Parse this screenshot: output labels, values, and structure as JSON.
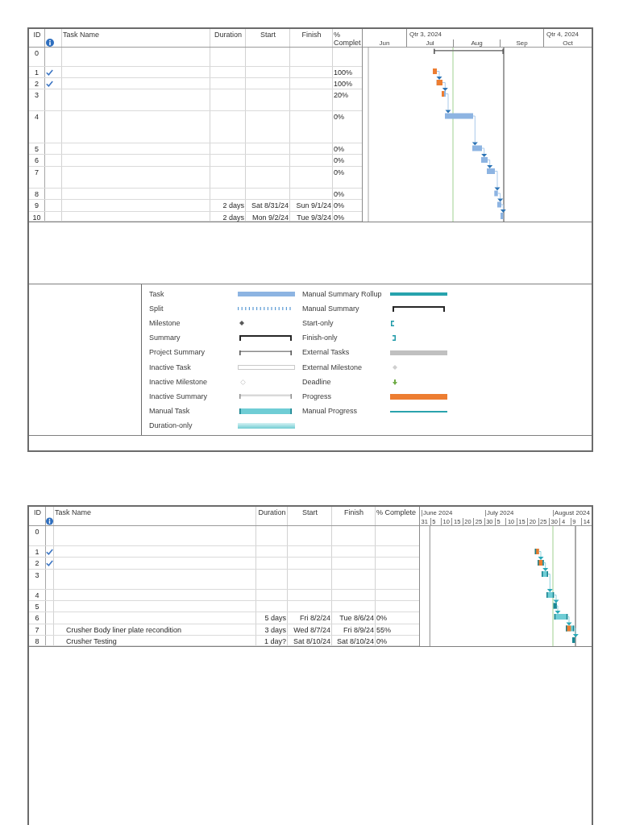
{
  "pages": [
    {
      "table": {
        "columns": [
          {
            "kind": "id",
            "label": "ID"
          },
          {
            "kind": "indicators"
          },
          {
            "kind": "name",
            "label": "Task Name"
          },
          {
            "kind": "duration",
            "label": "Duration"
          },
          {
            "kind": "start",
            "label": "Start"
          },
          {
            "kind": "finish",
            "label": "Finish"
          },
          {
            "kind": "complete",
            "label": "% Complet"
          }
        ],
        "rows": [
          {
            "id": "0",
            "done": false,
            "children": [
              {
                "id": "1",
                "done": true,
                "complete": "100%"
              },
              {
                "id": "2",
                "done": true,
                "complete": "100%"
              },
              {
                "id": "3",
                "done": false,
                "complete": "20%"
              },
              {
                "id": "4",
                "done": false,
                "complete": "0%"
              },
              {
                "id": "5",
                "done": false,
                "complete": "0%"
              },
              {
                "id": "6",
                "done": false,
                "complete": "0%"
              },
              {
                "id": "7",
                "done": false,
                "complete": "0%"
              },
              {
                "id": "8",
                "done": false,
                "complete": "0%"
              },
              {
                "id": "9",
                "done": false,
                "duration": "2 days",
                "start": "Sat 8/31/24",
                "finish": "Sun 9/1/24",
                "complete": "0%"
              },
              {
                "id": "10",
                "done": false,
                "duration": "2 days",
                "start": "Mon 9/2/24",
                "finish": "Tue 9/3/24",
                "complete": "0%"
              }
            ]
          }
        ]
      },
      "gantt": {
        "timescale": {
          "upper_tier": [
            "Qtr 3, 2024",
            "Qtr 4, 2024"
          ],
          "lower_tier": [
            "Jun",
            "Jul",
            "Aug",
            "Sep",
            "Oct"
          ]
        }
      },
      "legend": {
        "columns": [
          {
            "items": [
              {
                "label": "Task",
                "kind": "task"
              },
              {
                "label": "Split",
                "kind": "split"
              },
              {
                "label": "Milestone",
                "kind": "milestone"
              },
              {
                "label": "Summary",
                "kind": "summary"
              },
              {
                "label": "Project Summary",
                "kind": "project_summary"
              },
              {
                "label": "Inactive Task",
                "kind": "inactive_task"
              },
              {
                "label": "Inactive Milestone",
                "kind": "inactive_milestone"
              },
              {
                "label": "Inactive Summary",
                "kind": "inactive_summary"
              },
              {
                "label": "Manual Task",
                "kind": "manual_task"
              },
              {
                "label": "Duration-only",
                "kind": "duration_only"
              }
            ]
          },
          {
            "items": [
              {
                "label": "Manual Summary Rollup",
                "kind": "manual_summary_rollup"
              },
              {
                "label": "Manual Summary",
                "kind": "manual_summary"
              },
              {
                "label": "Start-only",
                "kind": "start_only"
              },
              {
                "label": "Finish-only",
                "kind": "finish_only"
              },
              {
                "label": "External Tasks",
                "kind": "external_tasks"
              },
              {
                "label": "External Milestone",
                "kind": "external_milestone"
              },
              {
                "label": "Deadline",
                "kind": "deadline"
              },
              {
                "label": "Progress",
                "kind": "progress"
              },
              {
                "label": "Manual Progress",
                "kind": "manual_progress"
              }
            ]
          }
        ]
      }
    },
    {
      "table": {
        "columns": [
          {
            "kind": "id",
            "label": "ID"
          },
          {
            "kind": "indicators"
          },
          {
            "kind": "name",
            "label": "Task Name"
          },
          {
            "kind": "duration",
            "label": "Duration"
          },
          {
            "kind": "start",
            "label": "Start"
          },
          {
            "kind": "finish",
            "label": "Finish"
          },
          {
            "kind": "complete",
            "label": "% Complete"
          }
        ],
        "rows": [
          {
            "id": "0",
            "done": false,
            "children": [
              {
                "id": "1",
                "done": true
              },
              {
                "id": "2",
                "done": true
              },
              {
                "id": "3",
                "done": false
              },
              {
                "id": "4",
                "done": false
              },
              {
                "id": "5",
                "done": false
              },
              {
                "id": "6",
                "done": false,
                "duration": "5 days",
                "start": "Fri 8/2/24",
                "finish": "Tue 8/6/24",
                "complete": "0%"
              },
              {
                "id": "7",
                "done": false,
                "name": "Crusher Body liner plate recondition",
                "duration": "3 days",
                "start": "Wed 8/7/24",
                "finish": "Fri 8/9/24",
                "complete": "55%"
              },
              {
                "id": "8",
                "done": false,
                "name": "Crusher Testing",
                "duration": "1 day?",
                "start": "Sat 8/10/24",
                "finish": "Sat 8/10/24",
                "complete": "0%"
              }
            ]
          }
        ]
      },
      "gantt": {
        "timescale": {
          "upper_tier": [
            "June 2024",
            "July 2024",
            "August 2024"
          ],
          "lower_tier": [
            "31",
            "5",
            "10",
            "15",
            "20",
            "25",
            "30",
            "5",
            "10",
            "15",
            "20",
            "25",
            "30",
            "4",
            "9",
            "14"
          ]
        }
      }
    }
  ]
}
